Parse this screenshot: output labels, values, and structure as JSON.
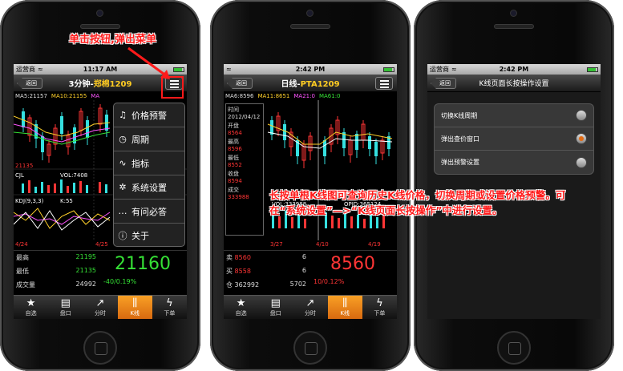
{
  "phone1": {
    "status": {
      "carrier": "运营商",
      "time": "11:17 AM"
    },
    "back": "返回",
    "title_main": "3分钟-",
    "title_sub": "郑棉1209",
    "ma": {
      "ma5": "MA5:21157",
      "ma10": "MA10:21155",
      "ma": "MA"
    },
    "low_label": "21135",
    "cjl": "CJL",
    "vol": "VOL:7408",
    "kdj": "KDJ(9,3,3)",
    "k": "K:55",
    "dates": [
      "4/24",
      "4/25"
    ],
    "quote": {
      "high_label": "最高",
      "high_val": "21195",
      "low_label": "最低",
      "low_val": "21135",
      "vol_label": "成交量",
      "vol_val": "24992",
      "price": "21160",
      "change": "-40/0.19%"
    },
    "menu": [
      {
        "icon": "bell-icon",
        "glyph": "♫",
        "label": "价格预警"
      },
      {
        "icon": "clock-icon",
        "glyph": "◷",
        "label": "周期"
      },
      {
        "icon": "indicator-icon",
        "glyph": "∿",
        "label": "指标"
      },
      {
        "icon": "gear-icon",
        "glyph": "✲",
        "label": "系统设置"
      },
      {
        "icon": "chat-icon",
        "glyph": "…",
        "label": "有问必答"
      },
      {
        "icon": "info-icon",
        "glyph": "ⓘ",
        "label": "关于"
      }
    ],
    "annotation": "单击按钮,弹出菜单"
  },
  "phone2": {
    "status": {
      "carrier": "",
      "time": "2:42 PM"
    },
    "back": "返回",
    "title_main": "日线-",
    "title_sub": "PTA1209",
    "ma": {
      "ma5": "MA6:8596",
      "ma10": "MA11:8651",
      "ma21": "MA21:0",
      "ma61": "MA61:0"
    },
    "info": [
      "时间",
      "2012/04/12",
      "开盘",
      "8564",
      "最高",
      "8596",
      "最低",
      "8552",
      "收盘",
      "8594",
      "成交",
      "333988"
    ],
    "vol": "VOL:333988",
    "opid": "OPID:365124",
    "dates": [
      "3/27",
      "4/10",
      "4/19"
    ],
    "quote": {
      "sell_label": "卖",
      "sell_val": "8560",
      "sell_qty": "6",
      "buy_label": "买",
      "buy_val": "8558",
      "buy_qty": "6",
      "pos_label": "仓",
      "pos_val": "362992",
      "pos_qty": "5702",
      "price": "8560",
      "change": "10/0.12%"
    },
    "annotation": "长按单根K线图可查询历史K线价格，切换周期或设置价格预警。可在“系统设置”—>“K线页面长按操作”中进行设置。"
  },
  "phone3": {
    "status": {
      "carrier": "运营商",
      "time": "2:42 PM"
    },
    "back": "返回",
    "title": "K线页面长按操作设置",
    "options": [
      {
        "label": "切换K线周期",
        "selected": false
      },
      {
        "label": "弹出查价窗口",
        "selected": true
      },
      {
        "label": "弹出预警设置",
        "selected": false
      }
    ]
  },
  "tabs": [
    {
      "icon": "star-icon",
      "glyph": "★",
      "label": "自选"
    },
    {
      "icon": "list-icon",
      "glyph": "▤",
      "label": "盘口"
    },
    {
      "icon": "trend-icon",
      "glyph": "↗",
      "label": "分时"
    },
    {
      "icon": "candlestick-icon",
      "glyph": "⫼",
      "label": "K线"
    },
    {
      "icon": "lightning-icon",
      "glyph": "ϟ",
      "label": "下单"
    }
  ]
}
